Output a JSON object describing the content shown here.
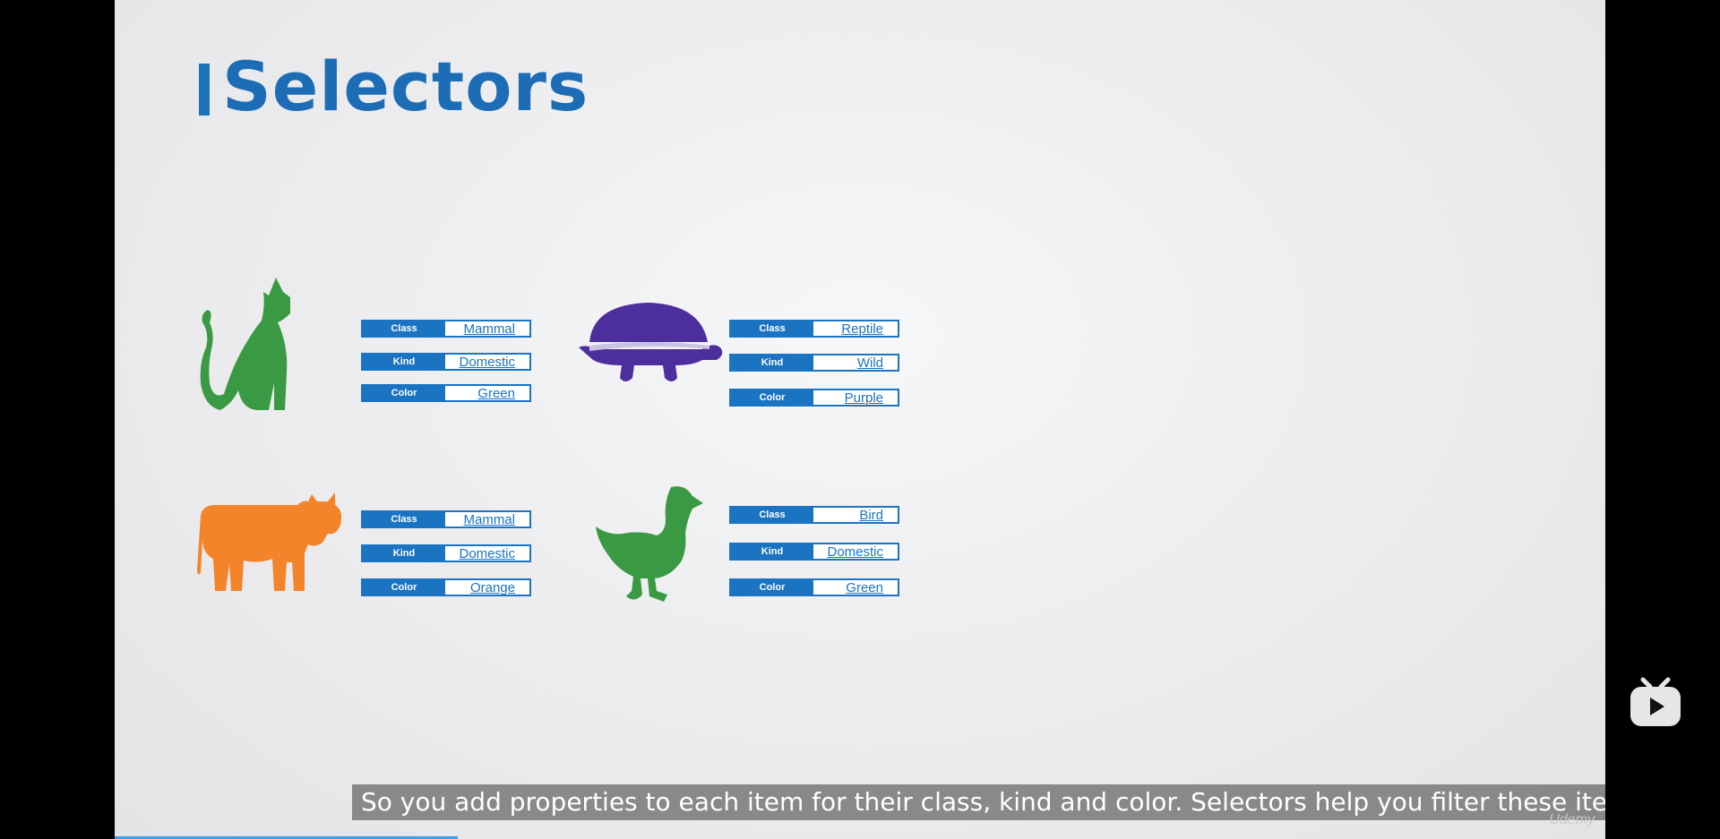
{
  "slide": {
    "title": "Selectors",
    "subtitle": "So you add properties to each item for their class, kind and color. Selectors help you filter these items.",
    "watermark": "Udemy"
  },
  "animals": [
    {
      "name": "cat",
      "icon": "cat-icon",
      "color": "#3a9a44",
      "props": [
        {
          "key": "Class",
          "value": "Mammal"
        },
        {
          "key": "Kind",
          "value": "Domestic"
        },
        {
          "key": "Color",
          "value": "Green"
        }
      ]
    },
    {
      "name": "turtle",
      "icon": "turtle-icon",
      "color": "#4c2f9c",
      "props": [
        {
          "key": "Class",
          "value": "Reptile"
        },
        {
          "key": "Kind",
          "value": "Wild"
        },
        {
          "key": "Color",
          "value": "Purple"
        }
      ]
    },
    {
      "name": "cow",
      "icon": "cow-icon",
      "color": "#f4842a",
      "props": [
        {
          "key": "Class",
          "value": "Mammal"
        },
        {
          "key": "Kind",
          "value": "Domestic"
        },
        {
          "key": "Color",
          "value": "Orange"
        }
      ]
    },
    {
      "name": "duck",
      "icon": "duck-icon",
      "color": "#3a9a44",
      "props": [
        {
          "key": "Class",
          "value": "Bird"
        },
        {
          "key": "Kind",
          "value": "Domestic"
        },
        {
          "key": "Color",
          "value": "Green"
        }
      ]
    }
  ],
  "player": {
    "progress_fraction": 0.23,
    "logo_icon": "tv-play-icon"
  }
}
